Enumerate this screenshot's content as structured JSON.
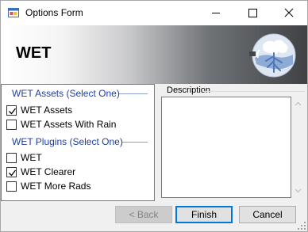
{
  "window": {
    "title": "Options Form"
  },
  "banner": {
    "title": "WET",
    "logo_icon": "globe-tree-logo"
  },
  "assets_group": {
    "header": "WET Assets (Select One)",
    "options": [
      {
        "label": "WET Assets",
        "checked": true
      },
      {
        "label": "WET Assets With Rain",
        "checked": false
      }
    ]
  },
  "plugins_group": {
    "header": "WET Plugins (Select One)",
    "options": [
      {
        "label": "WET",
        "checked": false
      },
      {
        "label": "WET Clearer",
        "checked": true
      },
      {
        "label": "WET More Rads",
        "checked": false
      }
    ]
  },
  "description": {
    "label": "Description",
    "text": ""
  },
  "buttons": {
    "back": "< Back",
    "finish": "Finish",
    "cancel": "Cancel"
  },
  "colors": {
    "accent": "#0078d7",
    "group_header": "#1f3fa0"
  }
}
